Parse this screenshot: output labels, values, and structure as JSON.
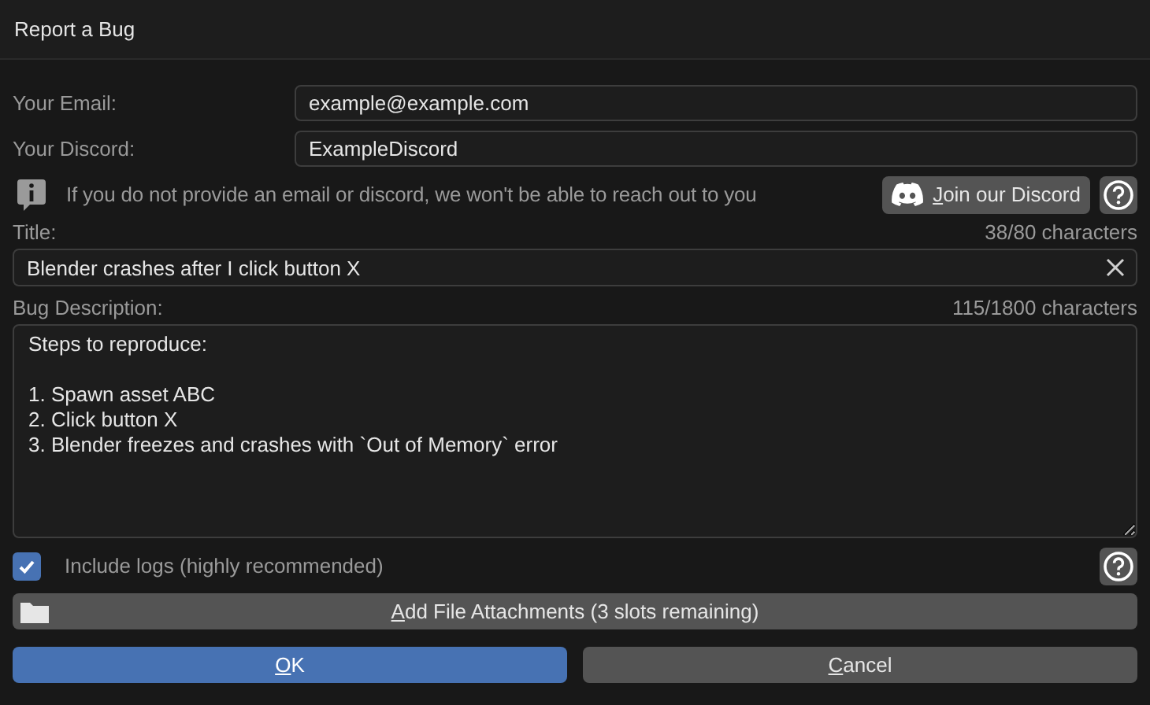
{
  "window": {
    "title": "Report a Bug"
  },
  "email": {
    "label": "Your Email:",
    "value": "example@example.com"
  },
  "discord": {
    "label": "Your Discord:",
    "value": "ExampleDiscord"
  },
  "notice": {
    "text": "If you do not provide an email or discord, we won't be able to reach out to you",
    "button": "Join our Discord"
  },
  "title_field": {
    "label": "Title:",
    "counter": "38/80 characters",
    "value": "Blender crashes after I click button X"
  },
  "description": {
    "label": "Bug Description:",
    "counter": "115/1800 characters",
    "value": "Steps to reproduce:\n\n1. Spawn asset ABC\n2. Click button X\n3. Blender freezes and crashes with `Out of Memory` error"
  },
  "include_logs": {
    "label": "Include logs (highly recommended)",
    "checked": true
  },
  "attach_button": "Add File Attachments (3 slots remaining)",
  "buttons": [
    {
      "label": "OK",
      "kind": "primary"
    },
    {
      "label": "Cancel",
      "kind": "secondary"
    }
  ]
}
